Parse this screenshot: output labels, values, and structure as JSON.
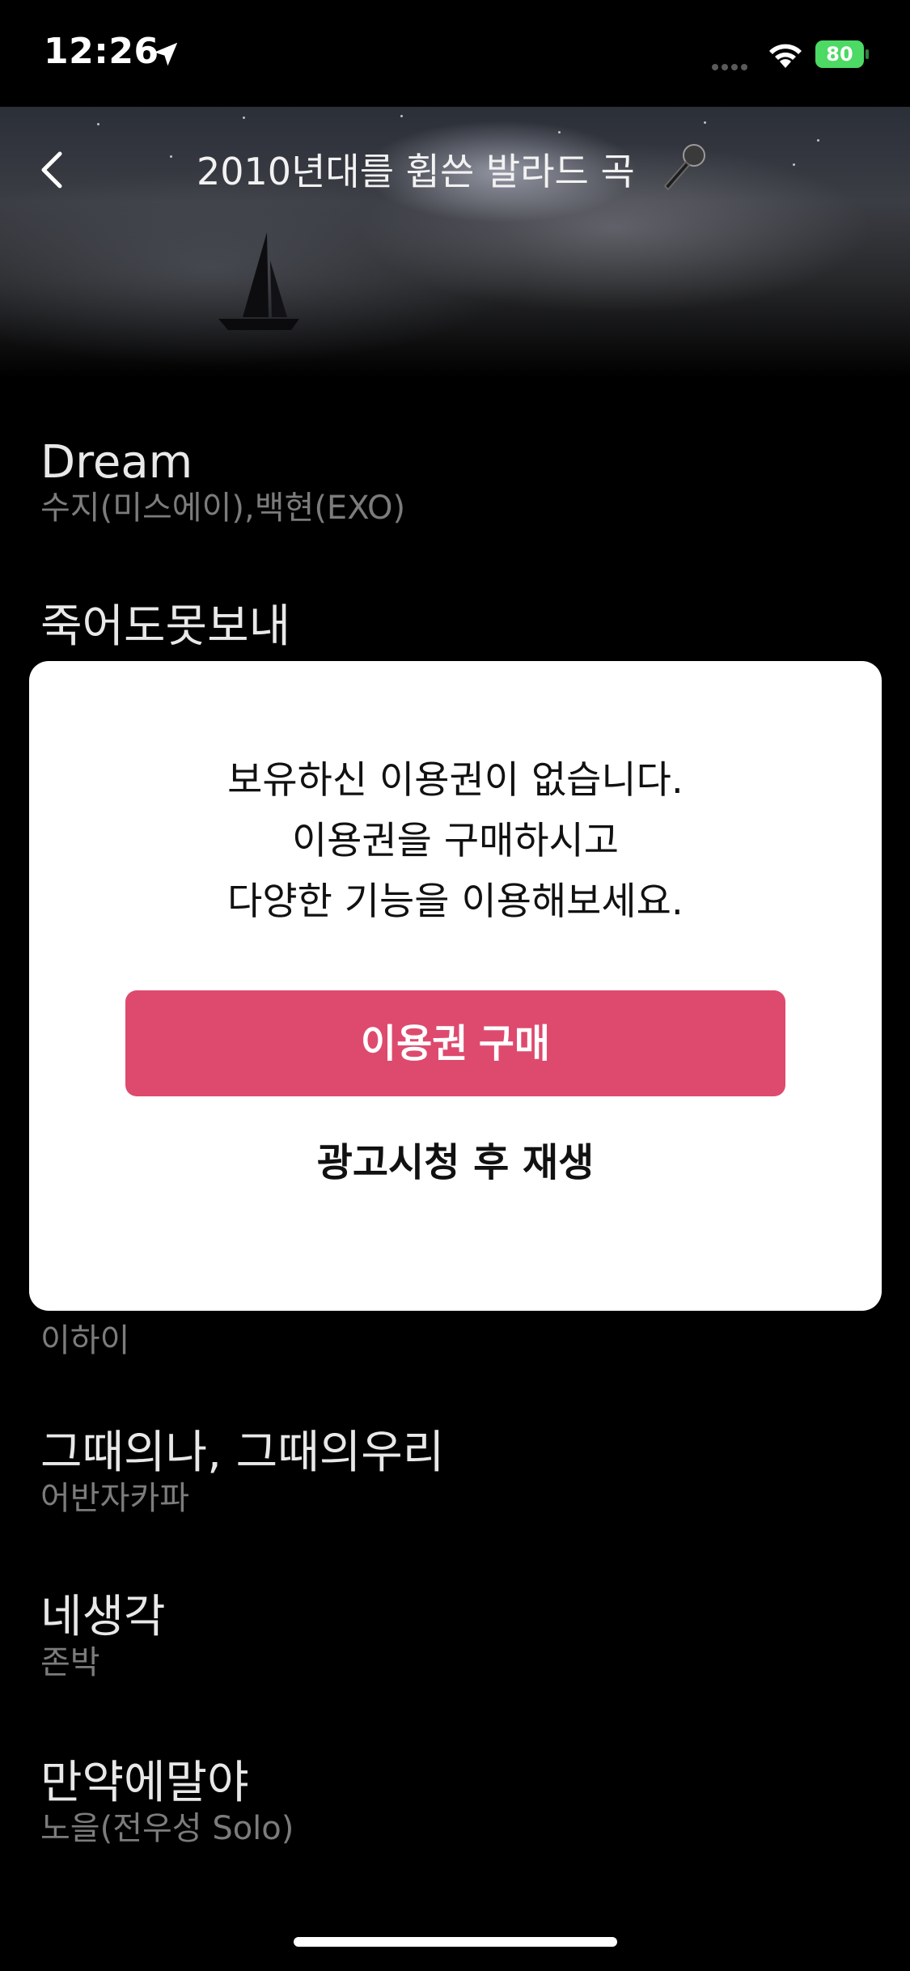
{
  "status_bar": {
    "time": "12:26",
    "battery": "80"
  },
  "header": {
    "title": "2010년대를 휩쓴 발라드 곡"
  },
  "songs": [
    {
      "title": "Dream",
      "artist": "수지(미스에이),백현(EXO)"
    },
    {
      "title": "죽어도못보내",
      "artist": ""
    },
    {
      "title": "",
      "artist": "이하이"
    },
    {
      "title": "그때의나, 그때의우리",
      "artist": "어반자카파"
    },
    {
      "title": "네생각",
      "artist": "존박"
    },
    {
      "title": "만약에말야",
      "artist": "노을(전우성 Solo)"
    }
  ],
  "modal": {
    "message_lines": [
      "보유하신 이용권이 없습니다.",
      "이용권을 구매하시고",
      "다양한 기능을 이용해보세요."
    ],
    "buy_button": "이용권 구매",
    "ad_button": "광고시청 후 재생"
  },
  "colors": {
    "accent": "#de4a6e",
    "battery": "#4cd964"
  }
}
